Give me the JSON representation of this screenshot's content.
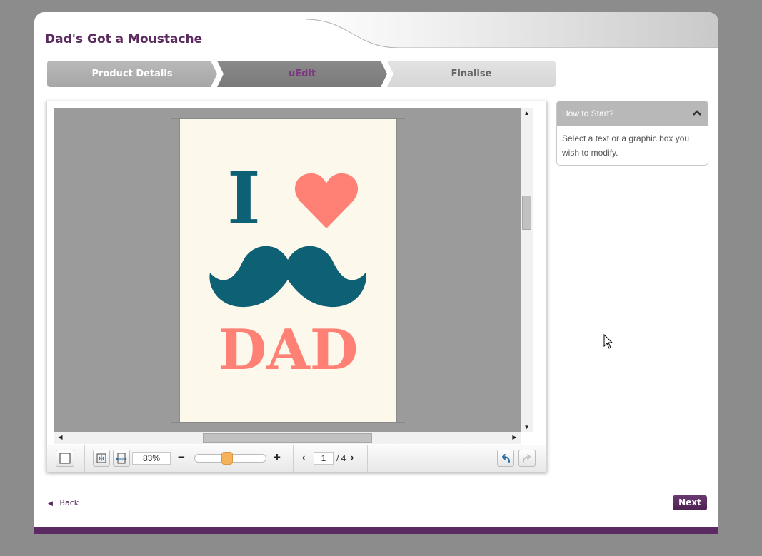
{
  "page": {
    "title": "Dad's Got a Moustache"
  },
  "steps": [
    {
      "label": "Product Details",
      "state": "completed"
    },
    {
      "label": "uEdit",
      "state": "current"
    },
    {
      "label": "Finalise",
      "state": "upcoming"
    }
  ],
  "card": {
    "line1_letter": "I",
    "line3_text": "DAD",
    "colors": {
      "teal": "#0e6075",
      "coral": "#ff8176",
      "background": "#fdf8ec"
    }
  },
  "toolbar": {
    "zoom_value": "83%",
    "zoom_minus": "−",
    "zoom_plus": "+",
    "zoom_level_fraction": 0.45,
    "current_page": "1",
    "total_pages": "/ 4"
  },
  "help": {
    "title": "How to Start?",
    "body": "Select a text or a graphic box you wish to modify."
  },
  "nav": {
    "back_label": "Back",
    "next_label": "Next"
  },
  "theme": {
    "accent": "#5c2a63",
    "slider_thumb": "#f4b25b"
  }
}
